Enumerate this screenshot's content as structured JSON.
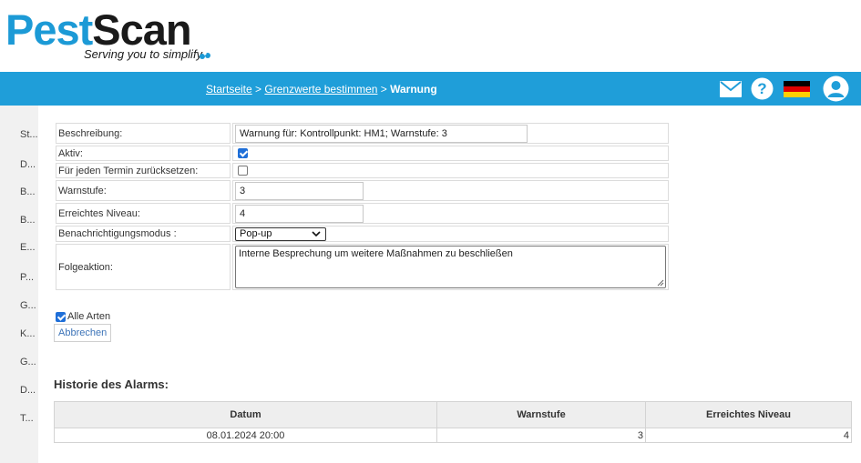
{
  "logo": {
    "brand_part1": "Pest",
    "brand_part2": "Scan",
    "tagline": "Serving you to simplify"
  },
  "breadcrumb": {
    "home": "Startseite",
    "sep1": " > ",
    "parent": "Grenzwerte bestimmen",
    "sep2": " > ",
    "current": "Warnung"
  },
  "header_icons": [
    "mail-icon",
    "help-icon",
    "german-flag-icon",
    "user-avatar-icon"
  ],
  "colors": {
    "brand_blue": "#1f9ed9",
    "logo_blue": "#1c9ad6",
    "flag_black": "#000000",
    "flag_red": "#dd0000",
    "flag_gold": "#ffce00"
  },
  "sidebar": {
    "items": [
      {
        "label": "St..."
      },
      {
        "label": "D..."
      },
      {
        "label": "B..."
      },
      {
        "label": "B..."
      },
      {
        "label": "E..."
      },
      {
        "label": "P..."
      },
      {
        "label": "G..."
      },
      {
        "label": "K..."
      },
      {
        "label": "G..."
      },
      {
        "label": "D..."
      },
      {
        "label": "T..."
      }
    ]
  },
  "form": {
    "description_label": "Beschreibung:",
    "description_value": "Warnung für: Kontrollpunkt: HM1; Warnstufe: 3",
    "active_label": "Aktiv:",
    "active_checked": true,
    "reset_label": "Für jeden Termin zurücksetzen:",
    "reset_checked": false,
    "warn_level_label": "Warnstufe:",
    "warn_level_value": "3",
    "reached_level_label": "Erreichtes Niveau:",
    "reached_level_value": "4",
    "notify_mode_label": "Benachrichtigungsmodus :",
    "notify_mode_value": "Pop-up",
    "follow_action_label": "Folgeaktion:",
    "follow_action_value": "Interne Besprechung um weitere Maßnahmen zu beschließen"
  },
  "all_types": {
    "label": "Alle Arten",
    "checked": true
  },
  "cancel_label": "Abbrechen",
  "history": {
    "title": "Historie des Alarms:",
    "columns": [
      "Datum",
      "Warnstufe",
      "Erreichtes Niveau"
    ],
    "rows": [
      {
        "date": "08.01.2024 20:00",
        "warn_level": "3",
        "reached_level": "4"
      }
    ]
  }
}
